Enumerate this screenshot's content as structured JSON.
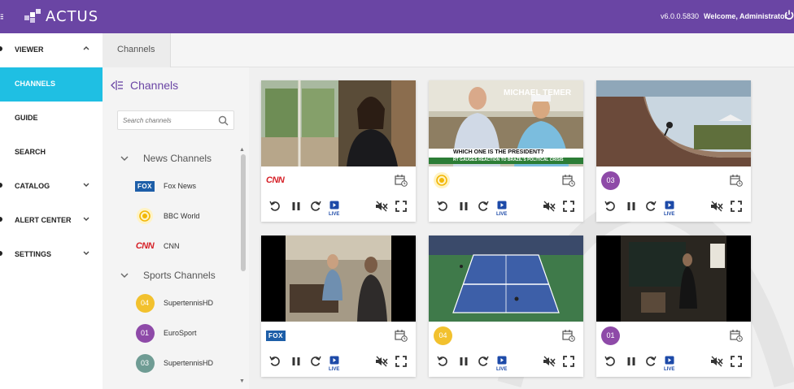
{
  "app": {
    "logo_text": "ACTUS",
    "version": "v6.0.0.5830",
    "welcome": "Welcome, Administrator"
  },
  "sidebar": {
    "items": [
      {
        "label": "VIEWER",
        "chevron": "up"
      },
      {
        "label": "CHANNELS",
        "active": true
      },
      {
        "label": "GUIDE"
      },
      {
        "label": "SEARCH"
      },
      {
        "label": "CATALOG",
        "chevron": "down"
      },
      {
        "label": "ALERT CENTER",
        "chevron": "down"
      },
      {
        "label": "SETTINGS",
        "chevron": "down"
      }
    ]
  },
  "tabs": [
    {
      "label": "Channels"
    }
  ],
  "channels_panel": {
    "title": "Channels",
    "search_placeholder": "Search channels",
    "groups": [
      {
        "label": "News Channels",
        "channels": [
          {
            "name": "Fox News",
            "logo": "fox",
            "logo_text": "FOX"
          },
          {
            "name": "BBC World",
            "logo": "bbc"
          },
          {
            "name": "CNN",
            "logo": "cnn",
            "logo_text": "CNN"
          }
        ]
      },
      {
        "label": "Sports Channels",
        "channels": [
          {
            "name": "SupertennisHD",
            "number": "04",
            "color": "#f2c12e"
          },
          {
            "name": "EuroSport",
            "number": "01",
            "color": "#8e4aa8"
          },
          {
            "name": "SupertennisHD",
            "number": "03",
            "color": "#6f9c94"
          }
        ]
      }
    ]
  },
  "tiles": [
    {
      "channel_logo": "cnn",
      "logo_text": "CNN"
    },
    {
      "channel_logo": "bbc",
      "overlay_name": "MICHAEL TEMER",
      "overlay_headline": "WHICH ONE IS THE PRESIDENT?",
      "overlay_sub": "RT GAUGES REACTION TO BRAZIL'S POLITICAL CRISIS"
    },
    {
      "channel_logo": "number",
      "number": "03",
      "color": "#8e4aa8"
    },
    {
      "channel_logo": "fox",
      "logo_text": "FOX"
    },
    {
      "channel_logo": "number",
      "number": "04",
      "color": "#f2c12e"
    },
    {
      "channel_logo": "number",
      "number": "01",
      "color": "#8e4aa8"
    }
  ],
  "controls": {
    "live_label": "LIVE"
  },
  "colors": {
    "brand": "#6a45a4",
    "active": "#1fbfe3"
  }
}
